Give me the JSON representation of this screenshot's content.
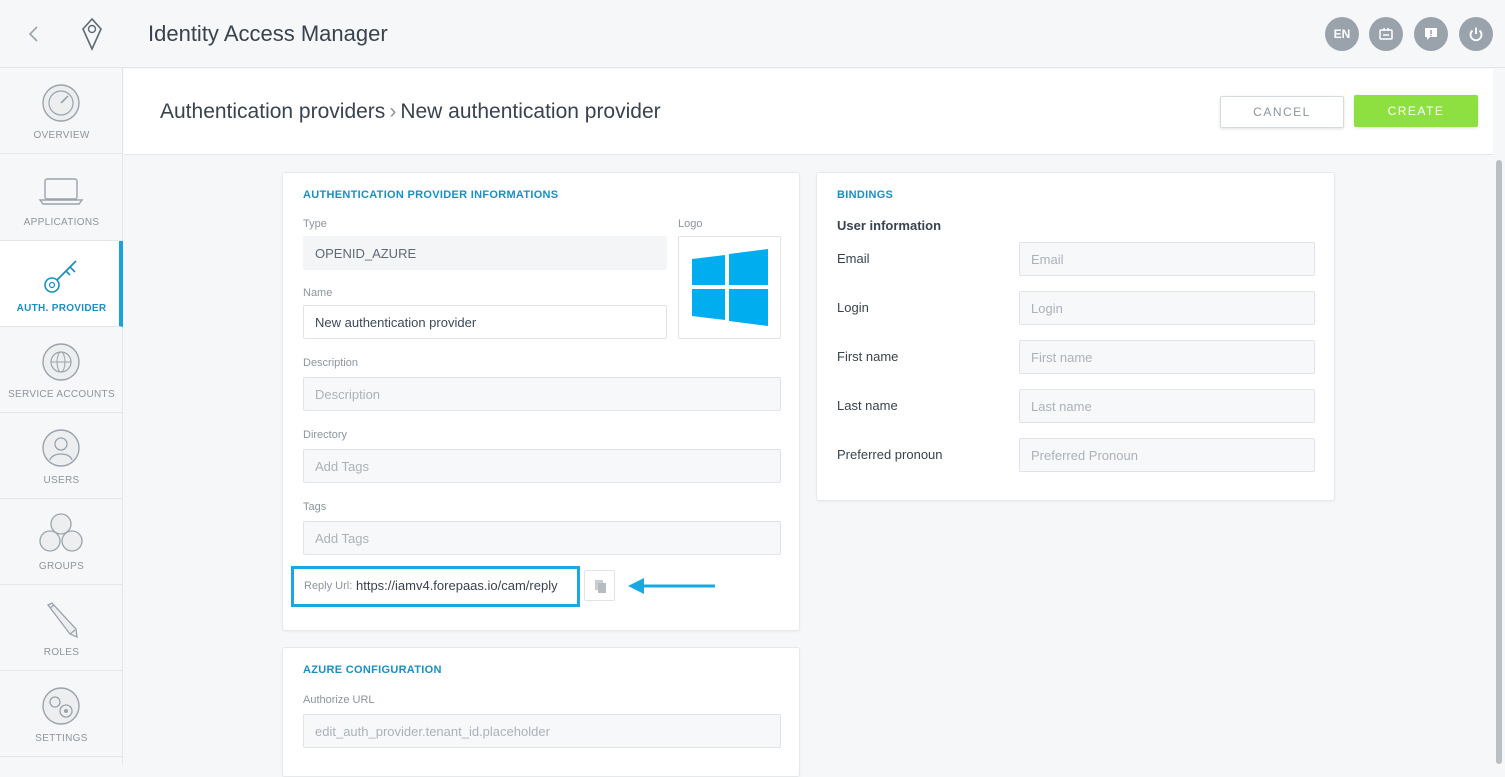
{
  "app": {
    "title": "Identity Access Manager",
    "language": "EN"
  },
  "topbar_icons": [
    "back-icon",
    "logo-icon",
    "language-badge",
    "board-icon",
    "feedback-icon",
    "power-icon"
  ],
  "sidebar": {
    "items": [
      {
        "label": "OVERVIEW",
        "icon": "gauge-icon",
        "active": false
      },
      {
        "label": "APPLICATIONS",
        "icon": "laptop-icon",
        "active": false
      },
      {
        "label": "AUTH. PROVIDER",
        "icon": "key-icon",
        "active": true
      },
      {
        "label": "SERVICE ACCOUNTS",
        "icon": "globe-icon",
        "active": false
      },
      {
        "label": "USERS",
        "icon": "user-icon",
        "active": false
      },
      {
        "label": "GROUPS",
        "icon": "group-icon",
        "active": false
      },
      {
        "label": "ROLES",
        "icon": "pencil-icon",
        "active": false
      },
      {
        "label": "SETTINGS",
        "icon": "gears-icon",
        "active": false
      }
    ]
  },
  "header": {
    "breadcrumb_parent": "Authentication providers",
    "breadcrumb_current": "New authentication provider",
    "cancel_label": "CANCEL",
    "create_label": "CREATE"
  },
  "info_card": {
    "title": "AUTHENTICATION PROVIDER INFORMATIONS",
    "type_label": "Type",
    "type_value": "OPENID_AZURE",
    "logo_label": "Logo",
    "name_label": "Name",
    "name_value": "New authentication provider",
    "description_label": "Description",
    "description_placeholder": "Description",
    "directory_label": "Directory",
    "directory_placeholder": "Add Tags",
    "tags_label": "Tags",
    "tags_placeholder": "Add Tags",
    "reply_label": "Reply Url:",
    "reply_value": "https://iamv4.forepaas.io/cam/reply"
  },
  "azure_card": {
    "title": "AZURE CONFIGURATION",
    "authorize_label": "Authorize URL",
    "authorize_placeholder": "edit_auth_provider.tenant_id.placeholder"
  },
  "bindings_card": {
    "title": "BINDINGS",
    "subtitle": "User information",
    "rows": [
      {
        "label": "Email",
        "placeholder": "Email"
      },
      {
        "label": "Login",
        "placeholder": "Login"
      },
      {
        "label": "First name",
        "placeholder": "First name"
      },
      {
        "label": "Last name",
        "placeholder": "Last name"
      },
      {
        "label": "Preferred pronoun",
        "placeholder": "Preferred Pronoun"
      }
    ]
  },
  "colors": {
    "accent": "#1a8fc2",
    "create_button": "#8ee040",
    "highlight": "#1aa8e0",
    "windows_logo": "#00adef"
  }
}
